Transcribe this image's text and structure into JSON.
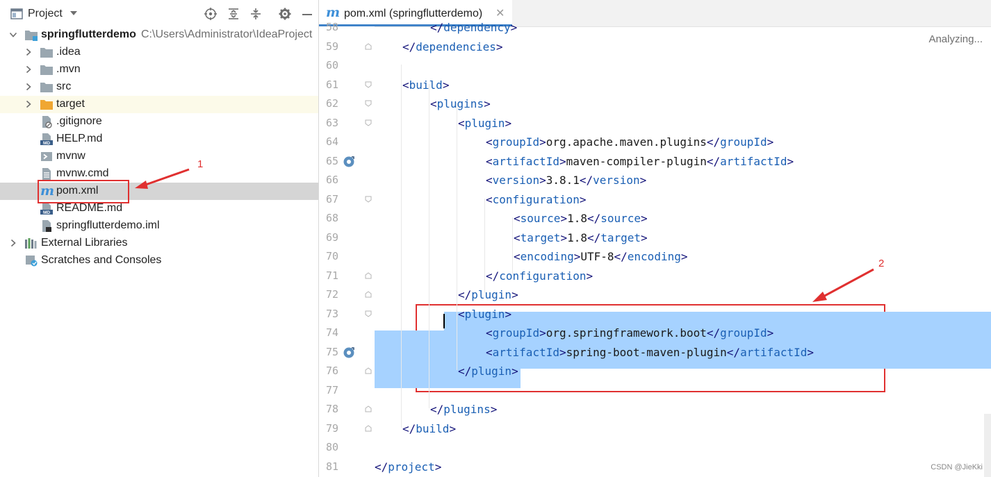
{
  "project_panel": {
    "title": "Project",
    "root": {
      "name": "springflutterdemo",
      "path": "C:\\Users\\Administrator\\IdeaProject"
    },
    "items": [
      {
        "label": ".idea",
        "icon": "folder-icon"
      },
      {
        "label": ".mvn",
        "icon": "folder-icon"
      },
      {
        "label": "src",
        "icon": "folder-icon"
      },
      {
        "label": "target",
        "icon": "folder-orange-icon"
      },
      {
        "label": ".gitignore",
        "icon": "ignore-file-icon"
      },
      {
        "label": "HELP.md",
        "icon": "markdown-file-icon"
      },
      {
        "label": "mvnw",
        "icon": "script-file-icon"
      },
      {
        "label": "mvnw.cmd",
        "icon": "text-file-icon"
      },
      {
        "label": "pom.xml",
        "icon": "maven-file-icon"
      },
      {
        "label": "README.md",
        "icon": "markdown-file-icon"
      },
      {
        "label": "springflutterdemo.iml",
        "icon": "iml-file-icon"
      },
      {
        "label": "External Libraries",
        "icon": "libraries-icon"
      },
      {
        "label": "Scratches and Consoles",
        "icon": "scratches-icon"
      }
    ]
  },
  "editor": {
    "tab_title": "pom.xml (springflutterdemo)",
    "status": "Analyzing...",
    "lines": [
      {
        "n": "58",
        "indent": 2,
        "parts": [
          [
            "<",
            "/dependency",
            ">"
          ]
        ]
      },
      {
        "n": "59",
        "indent": 1,
        "parts": [
          [
            "<",
            "/dependencies",
            ">"
          ]
        ]
      },
      {
        "n": "60",
        "indent": 0,
        "parts": []
      },
      {
        "n": "61",
        "indent": 1,
        "parts": [
          [
            "<",
            "build",
            ">"
          ]
        ]
      },
      {
        "n": "62",
        "indent": 2,
        "parts": [
          [
            "<",
            "plugins",
            ">"
          ]
        ]
      },
      {
        "n": "63",
        "indent": 3,
        "parts": [
          [
            "<",
            "plugin",
            ">"
          ]
        ]
      },
      {
        "n": "64",
        "indent": 4,
        "parts": [
          [
            "<",
            "groupId",
            ">"
          ],
          "org.apache.maven.plugins",
          [
            "</",
            "groupId",
            ">"
          ]
        ]
      },
      {
        "n": "65",
        "indent": 4,
        "parts": [
          [
            "<",
            "artifactId",
            ">"
          ],
          "maven-compiler-plugin",
          [
            "</",
            "artifactId",
            ">"
          ]
        ]
      },
      {
        "n": "66",
        "indent": 4,
        "parts": [
          [
            "<",
            "version",
            ">"
          ],
          "3.8.1",
          [
            "</",
            "version",
            ">"
          ]
        ]
      },
      {
        "n": "67",
        "indent": 4,
        "parts": [
          [
            "<",
            "configuration",
            ">"
          ]
        ]
      },
      {
        "n": "68",
        "indent": 5,
        "parts": [
          [
            "<",
            "source",
            ">"
          ],
          "1.8",
          [
            "</",
            "source",
            ">"
          ]
        ]
      },
      {
        "n": "69",
        "indent": 5,
        "parts": [
          [
            "<",
            "target",
            ">"
          ],
          "1.8",
          [
            "</",
            "target",
            ">"
          ]
        ]
      },
      {
        "n": "70",
        "indent": 5,
        "parts": [
          [
            "<",
            "encoding",
            ">"
          ],
          "UTF-8",
          [
            "</",
            "encoding",
            ">"
          ]
        ]
      },
      {
        "n": "71",
        "indent": 4,
        "parts": [
          [
            "</",
            "configuration",
            ">"
          ]
        ]
      },
      {
        "n": "72",
        "indent": 3,
        "parts": [
          [
            "</",
            "plugin",
            ">"
          ]
        ]
      },
      {
        "n": "73",
        "indent": 3,
        "parts": [
          [
            "<",
            "plugin",
            ">"
          ]
        ]
      },
      {
        "n": "74",
        "indent": 4,
        "parts": [
          [
            "<",
            "groupId",
            ">"
          ],
          "org.springframework.boot",
          [
            "</",
            "groupId",
            ">"
          ]
        ]
      },
      {
        "n": "75",
        "indent": 4,
        "parts": [
          [
            "<",
            "artifactId",
            ">"
          ],
          "spring-boot-maven-plugin",
          [
            "</",
            "artifactId",
            ">"
          ]
        ]
      },
      {
        "n": "76",
        "indent": 3,
        "parts": [
          [
            "</",
            "plugin",
            ">"
          ]
        ]
      },
      {
        "n": "77",
        "indent": 0,
        "parts": []
      },
      {
        "n": "78",
        "indent": 2,
        "parts": [
          [
            "</",
            "plugins",
            ">"
          ]
        ]
      },
      {
        "n": "79",
        "indent": 1,
        "parts": [
          [
            "</",
            "build",
            ">"
          ]
        ]
      },
      {
        "n": "80",
        "indent": 0,
        "parts": []
      },
      {
        "n": "81",
        "indent": 0,
        "parts": [
          [
            "</",
            "project",
            ">"
          ]
        ]
      }
    ]
  },
  "annotations": {
    "label1": "1",
    "label2": "2"
  },
  "watermark": "CSDN @JieKki",
  "colors": {
    "selection": "#a6d2ff",
    "annotation": "#e03030",
    "tab_underline": "#4083c9"
  }
}
